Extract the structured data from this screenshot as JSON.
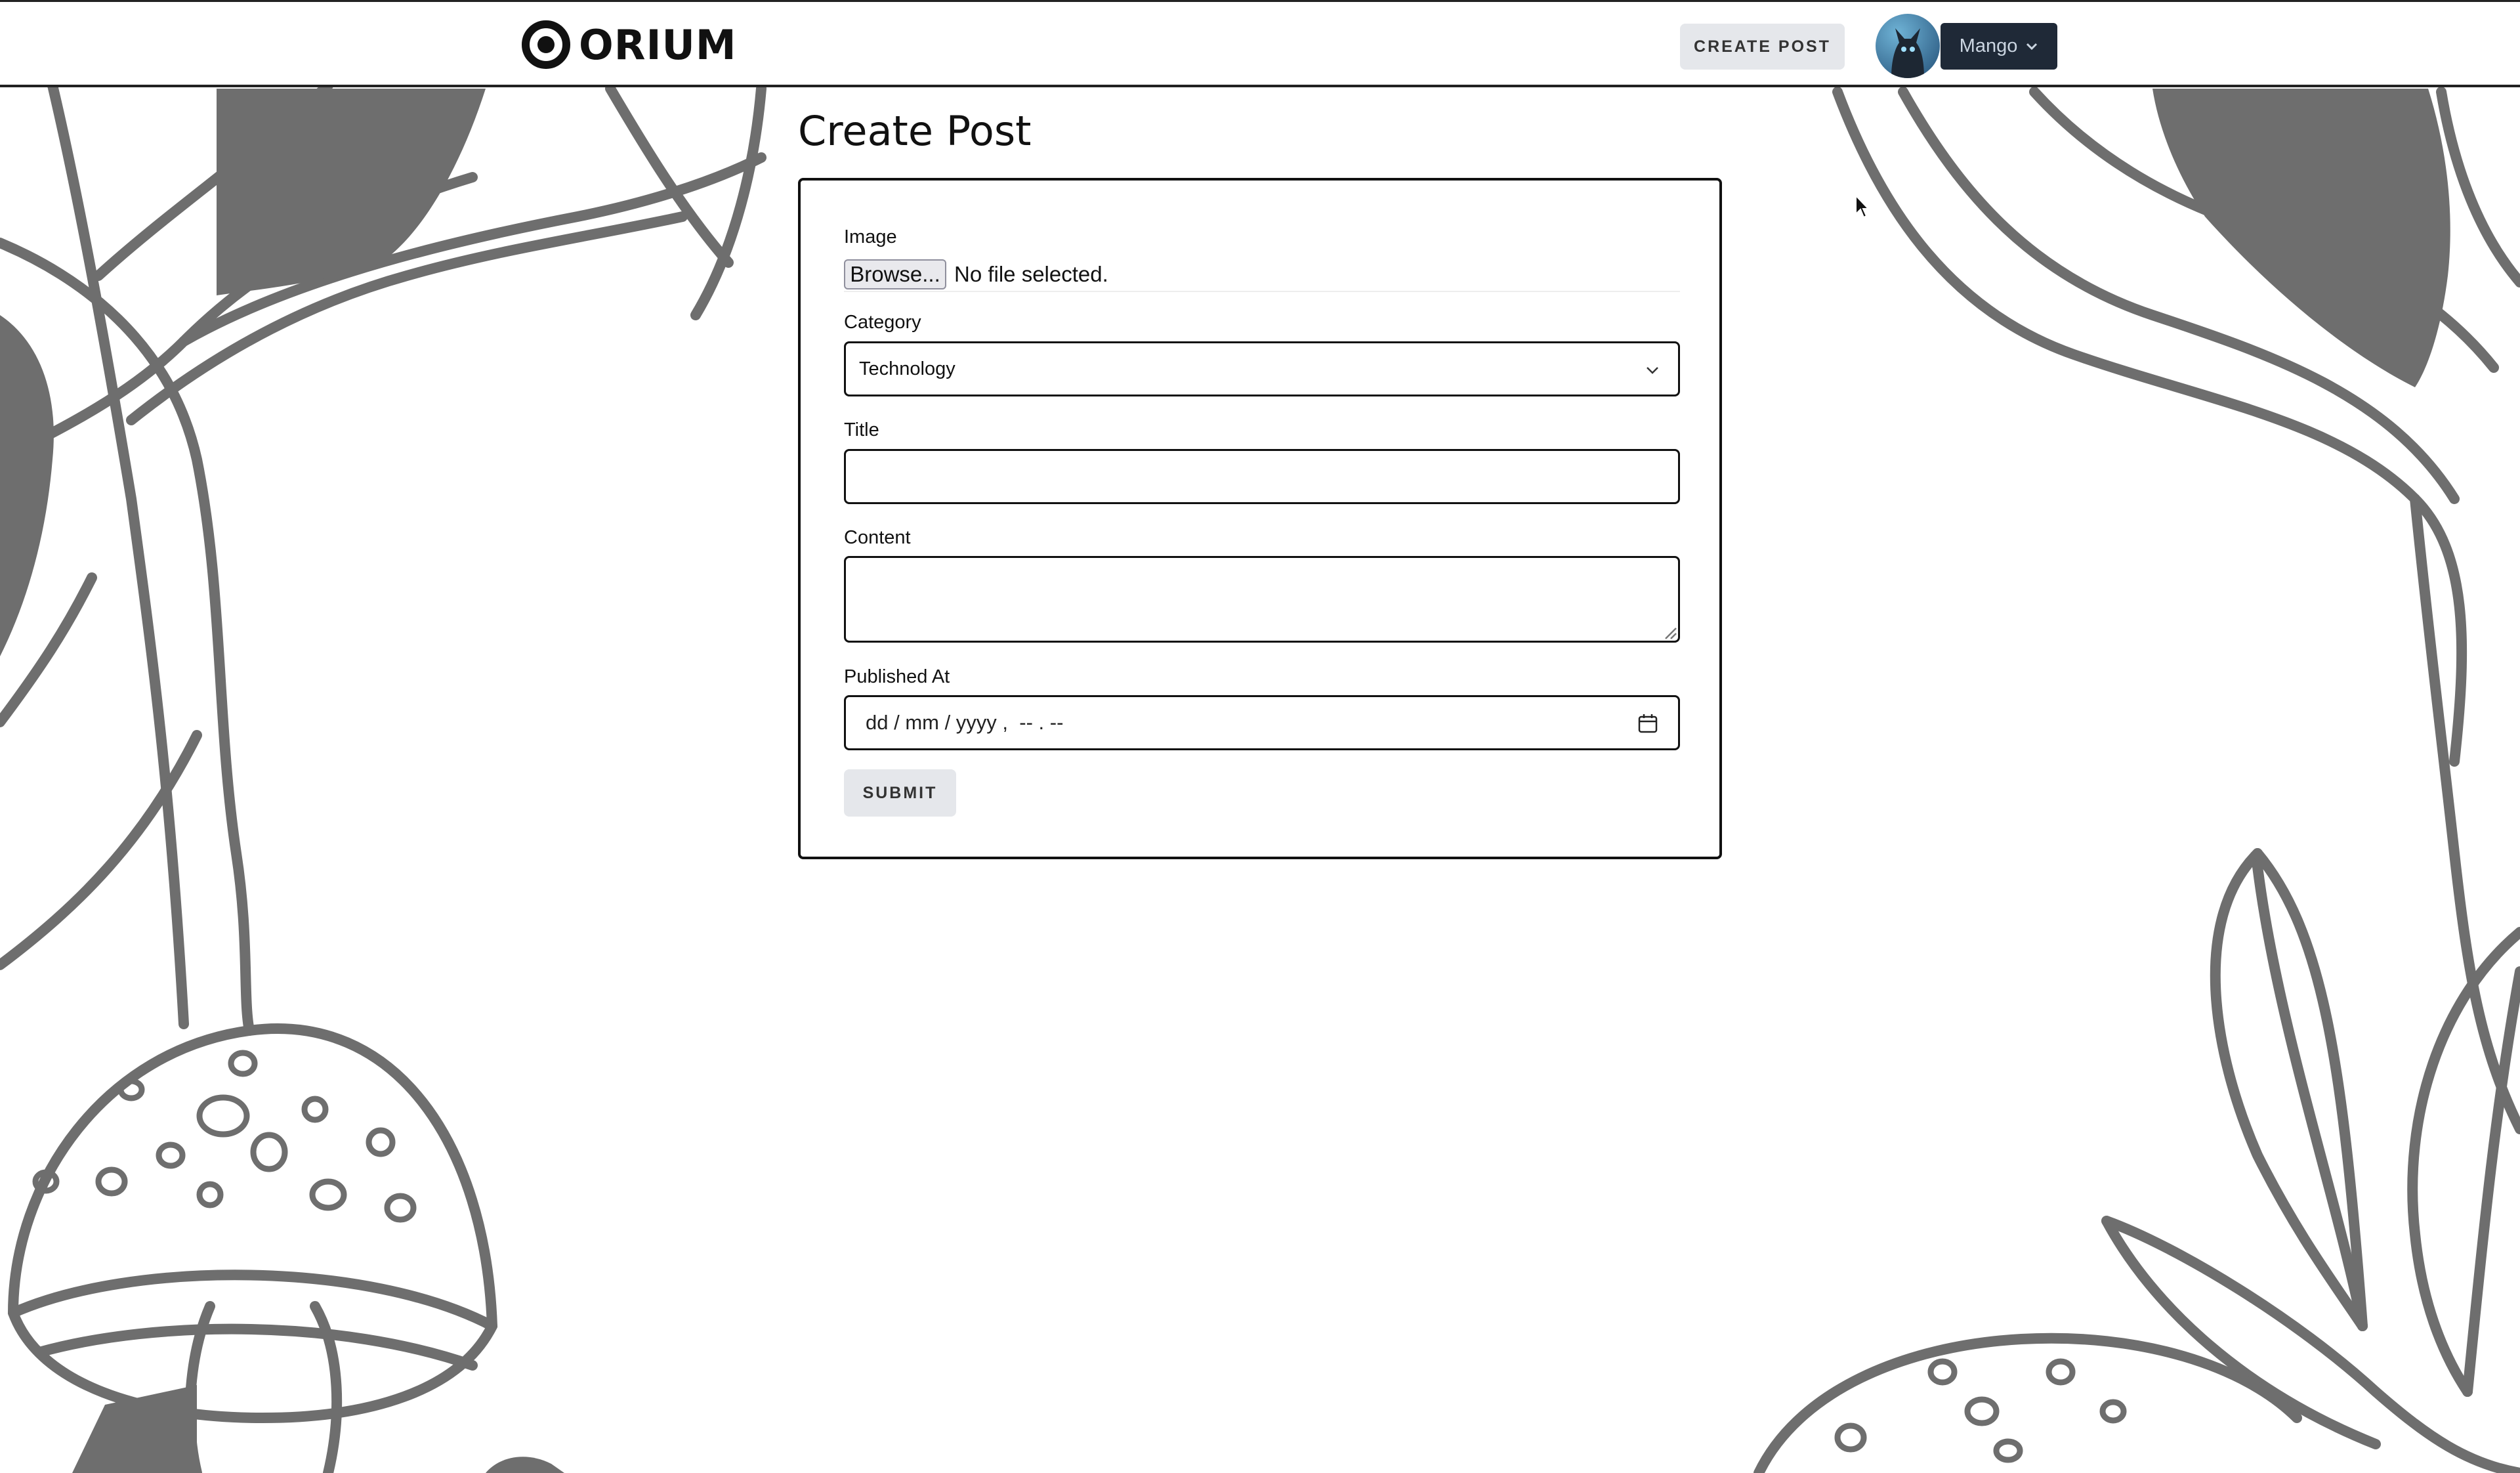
{
  "app": {
    "logo_text": "ORIUM",
    "icons": {
      "logo": "orium-logo-icon",
      "avatar": "cat-avatar",
      "dropdown": "chevron-down-icon",
      "calendar": "calendar-icon"
    }
  },
  "header": {
    "create_post_label": "CREATE POST",
    "user_name": "Mango"
  },
  "main": {
    "page_title": "Create Post",
    "form": {
      "image_label": "Image",
      "browse_label": "Browse...",
      "file_status": "No file selected.",
      "category_label": "Category",
      "category_value": "Technology",
      "title_label": "Title",
      "title_value": "",
      "content_label": "Content",
      "content_value": "",
      "published_label": "Published At",
      "published_placeholder": "dd / mm / yyyy ,  -- . --",
      "submit_label": "SUBMIT"
    }
  },
  "colors": {
    "text": "#111111",
    "button_bg": "#e5e7eb",
    "user_menu_bg": "#1f2937",
    "illustration_gray": "#6b6b6b"
  }
}
